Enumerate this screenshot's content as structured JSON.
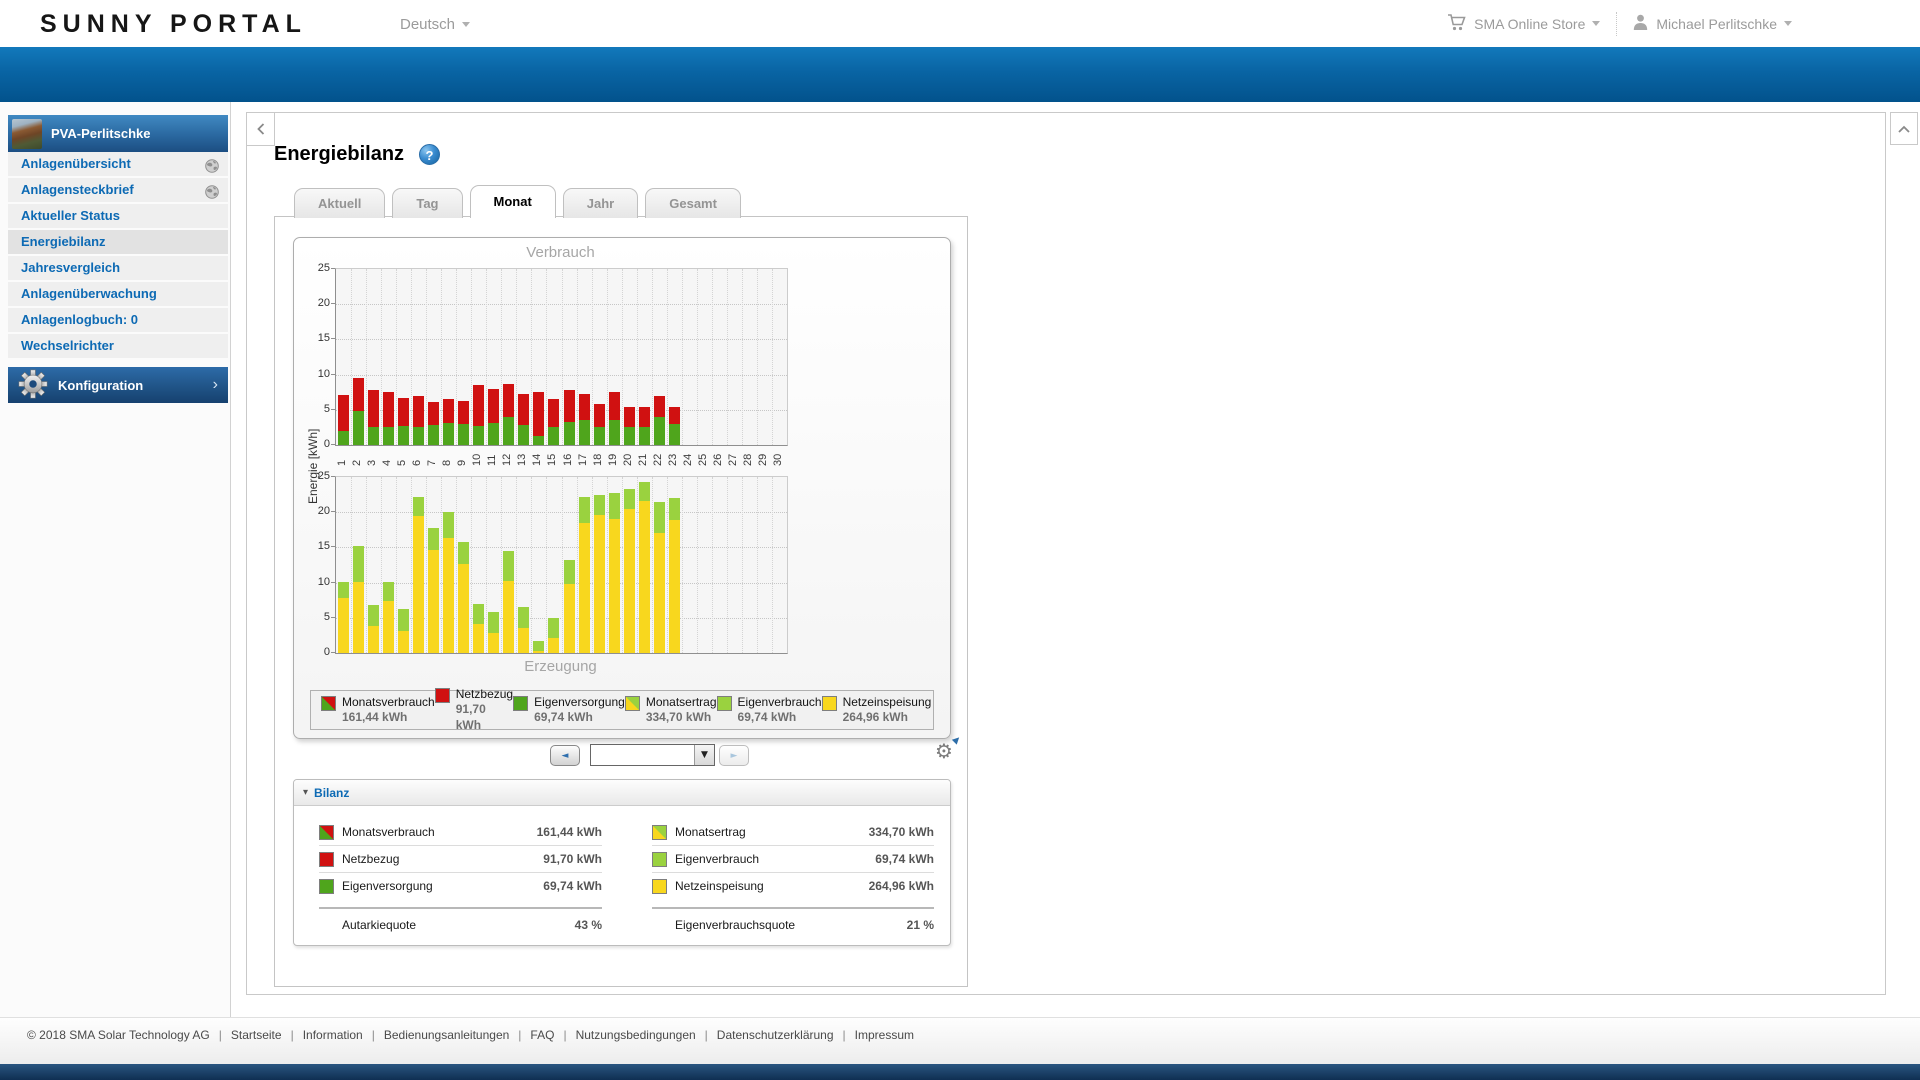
{
  "header": {
    "logo": "SUNNY PORTAL",
    "language": "Deutsch",
    "store": "SMA Online Store",
    "user": "Michael Perlitschke"
  },
  "sidebar": {
    "plant_name": "PVA-Perlitschke",
    "items": [
      {
        "key": "anlagenuebersicht",
        "label": "Anlagenübersicht",
        "globe": true
      },
      {
        "key": "anlagensteckbrief",
        "label": "Anlagensteckbrief",
        "globe": true
      },
      {
        "key": "aktueller-status",
        "label": "Aktueller Status"
      },
      {
        "key": "energiebilanz",
        "label": "Energiebilanz",
        "active": true
      },
      {
        "key": "jahresvergleich",
        "label": "Jahresvergleich"
      },
      {
        "key": "anlagenueberwachung",
        "label": "Anlagenüberwachung"
      },
      {
        "key": "anlagenlogbuch",
        "label": "Anlagenlogbuch: 0"
      },
      {
        "key": "wechselrichter",
        "label": "Wechselrichter"
      }
    ],
    "config_label": "Konfiguration"
  },
  "page": {
    "title": "Energiebilanz",
    "tabs": [
      {
        "key": "aktuell",
        "label": "Aktuell"
      },
      {
        "key": "tag",
        "label": "Tag"
      },
      {
        "key": "monat",
        "label": "Monat",
        "active": true
      },
      {
        "key": "jahr",
        "label": "Jahr"
      },
      {
        "key": "gesamt",
        "label": "Gesamt"
      }
    ]
  },
  "icons": {
    "help": "?",
    "prev": "◄",
    "next": "►",
    "dropdown": "▼",
    "gear": "⚙",
    "settings_pointer": "▲",
    "balance_collapse": "▾",
    "config_chevron": "›"
  },
  "chart_data": [
    {
      "type": "bar",
      "title": "Verbrauch",
      "stacked": true,
      "categories": [
        "1",
        "2",
        "3",
        "4",
        "5",
        "6",
        "7",
        "8",
        "9",
        "10",
        "11",
        "12",
        "13",
        "14",
        "15",
        "16",
        "17",
        "18",
        "19",
        "20",
        "21",
        "22",
        "23",
        "24",
        "25",
        "26",
        "27",
        "28",
        "29",
        "30"
      ],
      "series": [
        {
          "name": "Eigenversorgung",
          "color": "#4fa51c",
          "values": [
            2.0,
            4.9,
            2.6,
            2.5,
            2.7,
            2.6,
            2.9,
            3.2,
            3.0,
            2.7,
            3.1,
            4.0,
            2.8,
            1.3,
            2.5,
            3.3,
            3.5,
            2.6,
            3.5,
            2.6,
            2.5,
            4.0,
            3.0,
            0,
            0,
            0,
            0,
            0,
            0,
            0
          ]
        },
        {
          "name": "Netzbezug",
          "color": "#d01111",
          "values": [
            5.1,
            4.6,
            5.2,
            5.0,
            4.0,
            4.3,
            3.2,
            3.4,
            3.3,
            5.8,
            4.9,
            4.6,
            4.4,
            6.2,
            4.0,
            4.5,
            3.7,
            3.3,
            4.0,
            2.8,
            2.9,
            2.9,
            2.4,
            0,
            0,
            0,
            0,
            0,
            0,
            0
          ]
        }
      ],
      "ylabel": "Energie [kWh]",
      "ylim": [
        0,
        25
      ],
      "yticks": [
        0,
        5,
        10,
        15,
        20,
        25
      ],
      "grid": true,
      "legend_position": "bottom"
    },
    {
      "type": "bar",
      "title": "Erzeugung",
      "stacked": true,
      "categories": [
        "1",
        "2",
        "3",
        "4",
        "5",
        "6",
        "7",
        "8",
        "9",
        "10",
        "11",
        "12",
        "13",
        "14",
        "15",
        "16",
        "17",
        "18",
        "19",
        "20",
        "21",
        "22",
        "23",
        "24",
        "25",
        "26",
        "27",
        "28",
        "29",
        "30"
      ],
      "series": [
        {
          "name": "Netzeinspeisung",
          "color": "#f8d71e",
          "values": [
            7.8,
            10.1,
            3.9,
            7.4,
            3.1,
            19.4,
            14.6,
            16.4,
            12.7,
            4.1,
            2.8,
            10.3,
            3.5,
            0.3,
            2.2,
            9.8,
            18.5,
            19.6,
            19.1,
            20.5,
            21.6,
            17.1,
            18.9,
            0,
            0,
            0,
            0,
            0,
            0,
            0
          ]
        },
        {
          "name": "Eigenverbrauch",
          "color": "#9ad23f",
          "values": [
            2.3,
            5.1,
            2.9,
            2.7,
            3.1,
            2.8,
            3.2,
            3.6,
            3.1,
            2.9,
            3.1,
            4.2,
            3.0,
            1.4,
            2.8,
            3.4,
            3.7,
            2.9,
            3.7,
            2.8,
            2.7,
            4.3,
            3.1,
            0,
            0,
            0,
            0,
            0,
            0,
            0
          ]
        }
      ],
      "ylabel": "Energie [kWh]",
      "ylim": [
        0,
        25
      ],
      "yticks": [
        0,
        5,
        10,
        15,
        20,
        25
      ],
      "grid": true,
      "legend_position": "bottom"
    }
  ],
  "chart_legend": [
    {
      "key": "monatsverbrauch",
      "label": "Monatsverbrauch",
      "value": "161,44 kWh",
      "icon": "split-red-green"
    },
    {
      "key": "netzbezug",
      "label": "Netzbezug",
      "value": "91,70 kWh",
      "icon": "red"
    },
    {
      "key": "eigenversorgung",
      "label": "Eigenversorgung",
      "value": "69,74 kWh",
      "icon": "dark-green"
    },
    {
      "key": "monatsertrag",
      "label": "Monatsertrag",
      "value": "334,70 kWh",
      "icon": "split-green-yellow"
    },
    {
      "key": "eigenverbrauch",
      "label": "Eigenverbrauch",
      "value": "69,74 kWh",
      "icon": "light-green"
    },
    {
      "key": "netzeinspeisung",
      "label": "Netzeinspeisung",
      "value": "264,96 kWh",
      "icon": "yellow"
    }
  ],
  "balance": {
    "title": "Bilanz",
    "left_rows": [
      {
        "key": "monatsverbrauch",
        "label": "Monatsverbrauch",
        "value": "161,44 kWh",
        "icon": "split-red-green"
      },
      {
        "key": "netzbezug",
        "label": "Netzbezug",
        "value": "91,70 kWh",
        "icon": "red"
      },
      {
        "key": "eigenversorgung",
        "label": "Eigenversorgung",
        "value": "69,74 kWh",
        "icon": "dark-green"
      }
    ],
    "right_rows": [
      {
        "key": "monatsertrag",
        "label": "Monatsertrag",
        "value": "334,70 kWh",
        "icon": "split-green-yellow"
      },
      {
        "key": "eigenverbrauch",
        "label": "Eigenverbrauch",
        "value": "69,74 kWh",
        "icon": "light-green"
      },
      {
        "key": "netzeinspeisung",
        "label": "Netzeinspeisung",
        "value": "264,96 kWh",
        "icon": "yellow"
      }
    ],
    "left_quote": {
      "label": "Autarkiequote",
      "value": "43 %"
    },
    "right_quote": {
      "label": "Eigenverbrauchsquote",
      "value": "21 %"
    }
  },
  "footer": {
    "copyright": "© 2018 SMA Solar Technology AG",
    "links": [
      "Startseite",
      "Information",
      "Bedienungsanleitungen",
      "FAQ",
      "Nutzungsbedingungen",
      "Datenschutzerklärung",
      "Impressum"
    ]
  },
  "colors": {
    "accent_blue": "#0d6ab4",
    "brand_bar_top": "#1279bc",
    "brand_bar_bottom": "#02528c",
    "netzbezug_red": "#d01111",
    "eigenversorgung_green": "#4fa51c",
    "eigenverbrauch_green": "#9ad23f",
    "netzeinspeisung_yellow": "#f8d71e"
  }
}
